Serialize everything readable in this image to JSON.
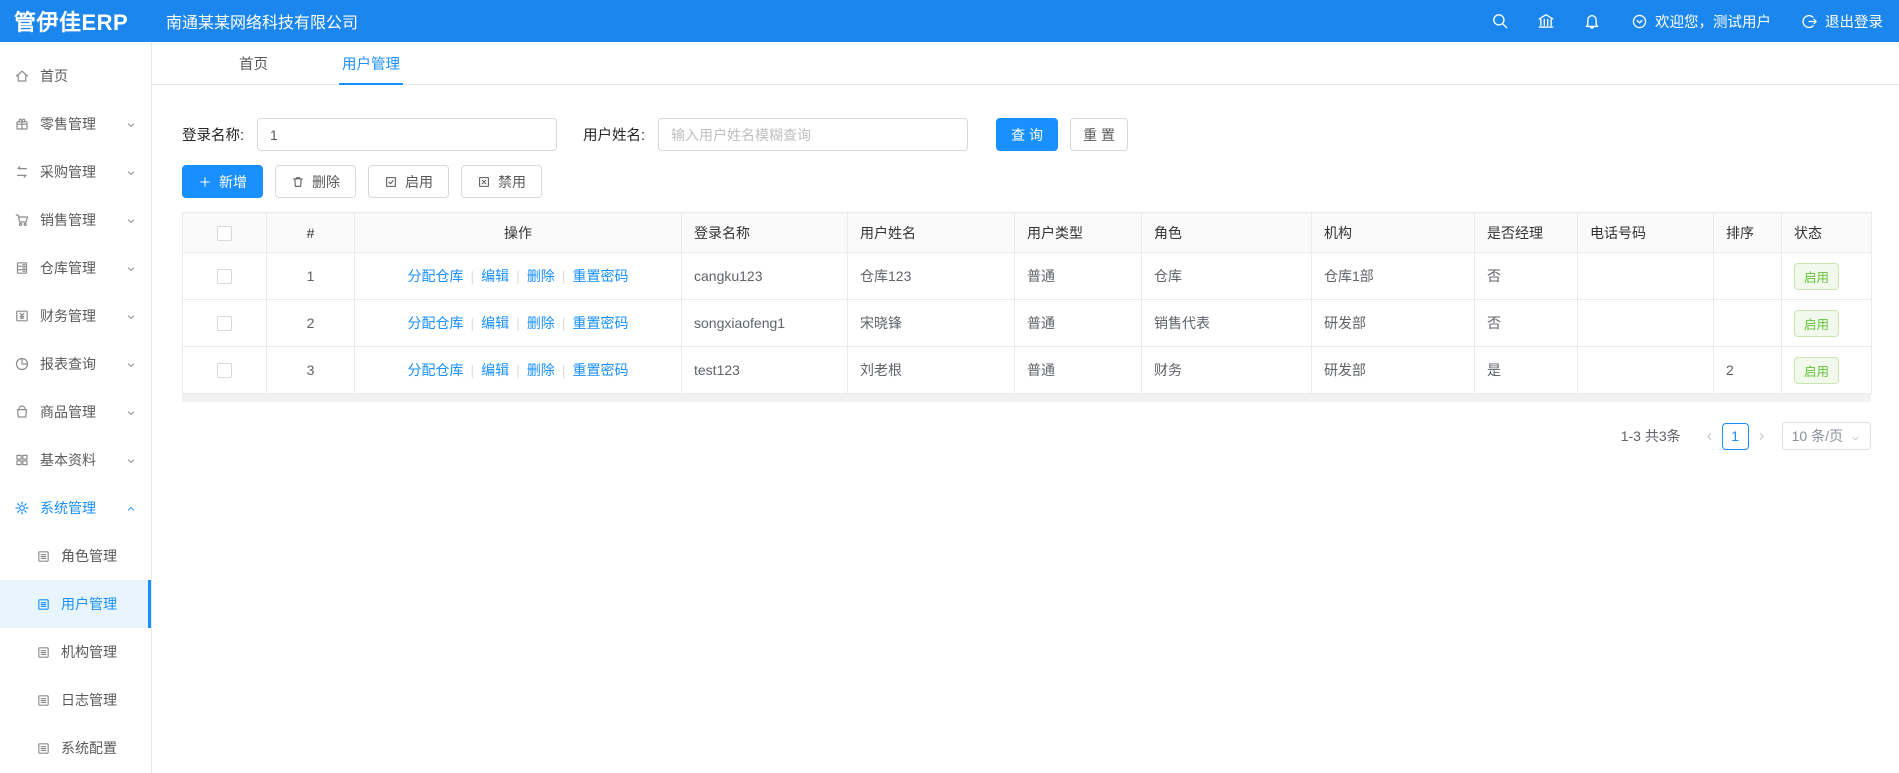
{
  "colors": {
    "header_bg": "#1b87ee",
    "accent": "#1890ff",
    "success_text": "#67c23a",
    "success_bg": "#f0f9eb",
    "success_border": "#c8e6b2"
  },
  "header": {
    "logo": "管伊佳ERP",
    "company": "南通某某网络科技有限公司",
    "icons": [
      "search-icon",
      "bank-icon",
      "bell-icon"
    ],
    "welcome": "欢迎您，测试用户",
    "welcome_icon": "user-circle-icon",
    "logout": "退出登录",
    "logout_icon": "logout-icon"
  },
  "sidebar": {
    "items": [
      {
        "label": "首页",
        "icon": "home-icon"
      },
      {
        "label": "零售管理",
        "icon": "retail-icon",
        "chevron": "down"
      },
      {
        "label": "采购管理",
        "icon": "purchase-icon",
        "chevron": "down"
      },
      {
        "label": "销售管理",
        "icon": "sales-icon",
        "chevron": "down"
      },
      {
        "label": "仓库管理",
        "icon": "warehouse-icon",
        "chevron": "down"
      },
      {
        "label": "财务管理",
        "icon": "finance-icon",
        "chevron": "down"
      },
      {
        "label": "报表查询",
        "icon": "report-icon",
        "chevron": "down"
      },
      {
        "label": "商品管理",
        "icon": "goods-icon",
        "chevron": "down"
      },
      {
        "label": "基本资料",
        "icon": "basic-icon",
        "chevron": "down"
      },
      {
        "label": "系统管理",
        "icon": "gear-icon",
        "chevron": "up",
        "active": true
      }
    ],
    "sub_items": [
      {
        "label": "角色管理",
        "icon": "list-icon"
      },
      {
        "label": "用户管理",
        "icon": "list-icon",
        "active": true
      },
      {
        "label": "机构管理",
        "icon": "list-icon"
      },
      {
        "label": "日志管理",
        "icon": "list-icon"
      },
      {
        "label": "系统配置",
        "icon": "list-icon"
      }
    ]
  },
  "tabs": [
    {
      "label": "首页"
    },
    {
      "label": "用户管理",
      "active": true
    }
  ],
  "filters": {
    "login_label": "登录名称:",
    "login_value": "1",
    "name_label": "用户姓名:",
    "name_placeholder": "输入用户姓名模糊查询",
    "search_button": "查 询",
    "reset_button": "重 置"
  },
  "toolbar": {
    "buttons": [
      {
        "label": "新增",
        "icon": "plus-icon",
        "primary": true
      },
      {
        "label": "删除",
        "icon": "trash-icon"
      },
      {
        "label": "启用",
        "icon": "check-square-icon"
      },
      {
        "label": "禁用",
        "icon": "x-square-icon"
      }
    ]
  },
  "table": {
    "columns": [
      "#",
      "操作",
      "登录名称",
      "用户姓名",
      "用户类型",
      "角色",
      "机构",
      "是否经理",
      "电话号码",
      "排序",
      "状态"
    ],
    "action_labels": [
      "分配仓库",
      "编辑",
      "删除",
      "重置密码"
    ],
    "rows": [
      {
        "index": "1",
        "login": "cangku123",
        "name": "仓库123",
        "type": "普通",
        "role": "仓库",
        "org": "仓库1部",
        "manager": "否",
        "phone": "",
        "sort": "",
        "status": "启用"
      },
      {
        "index": "2",
        "login": "songxiaofeng1",
        "name": "宋晓锋",
        "type": "普通",
        "role": "销售代表",
        "org": "研发部",
        "manager": "否",
        "phone": "",
        "sort": "",
        "status": "启用"
      },
      {
        "index": "3",
        "login": "test123",
        "name": "刘老根",
        "type": "普通",
        "role": "财务",
        "org": "研发部",
        "manager": "是",
        "phone": "",
        "sort": "2",
        "status": "启用"
      }
    ]
  },
  "pagination": {
    "total_text": "1-3 共3条",
    "current_page": "1",
    "page_size": "10 条/页"
  }
}
